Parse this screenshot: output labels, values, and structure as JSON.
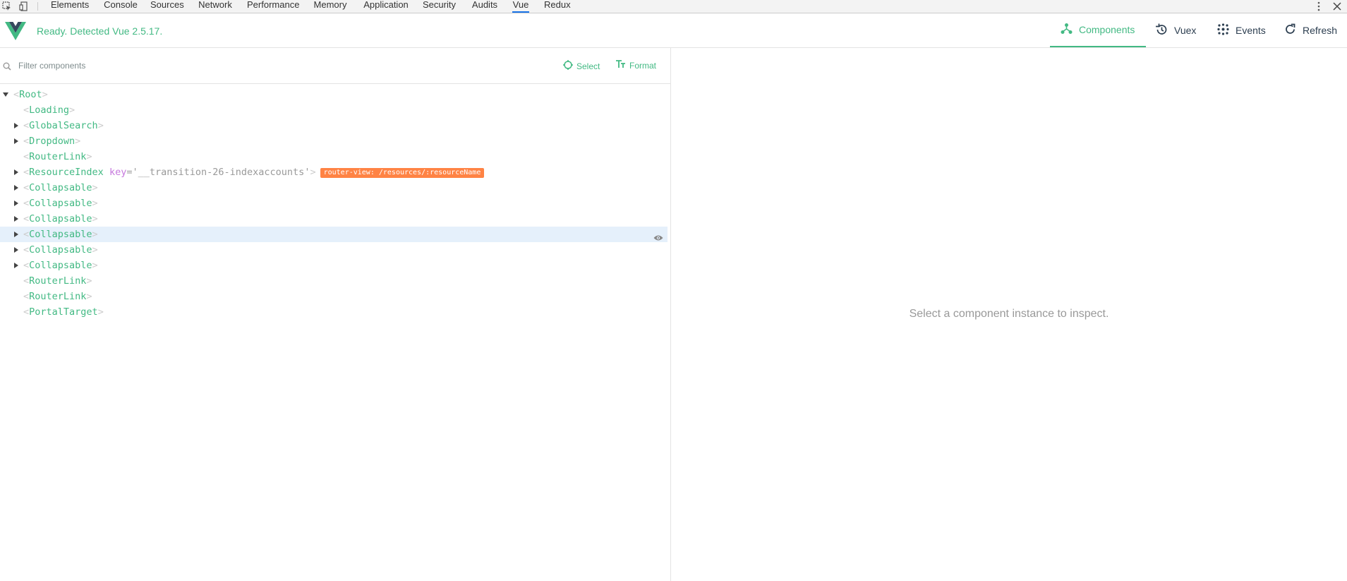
{
  "devtools": {
    "tabs": [
      {
        "label": "Elements"
      },
      {
        "label": "Console"
      },
      {
        "label": "Sources"
      },
      {
        "label": "Network"
      },
      {
        "label": "Performance"
      },
      {
        "label": "Memory"
      },
      {
        "label": "Application"
      },
      {
        "label": "Security"
      },
      {
        "label": "Audits"
      },
      {
        "label": "Vue"
      },
      {
        "label": "Redux"
      }
    ],
    "active_tab": "Vue"
  },
  "header": {
    "status": "Ready. Detected Vue 2.5.17.",
    "nav": [
      {
        "label": "Components",
        "icon": "components-icon",
        "active": true
      },
      {
        "label": "Vuex",
        "icon": "history-icon",
        "active": false
      },
      {
        "label": "Events",
        "icon": "events-icon",
        "active": false
      },
      {
        "label": "Refresh",
        "icon": "refresh-icon",
        "active": false
      }
    ]
  },
  "filter": {
    "placeholder": "Filter components",
    "select_label": "Select",
    "format_label": "Format"
  },
  "tree": [
    {
      "name": "Root",
      "depth": 0,
      "expand": "down"
    },
    {
      "name": "Loading",
      "depth": 1,
      "expand": "none"
    },
    {
      "name": "GlobalSearch",
      "depth": 1,
      "expand": "right"
    },
    {
      "name": "Dropdown",
      "depth": 1,
      "expand": "right"
    },
    {
      "name": "RouterLink",
      "depth": 1,
      "expand": "none"
    },
    {
      "name": "ResourceIndex",
      "depth": 1,
      "expand": "right",
      "key_attr": "key",
      "key_value": "'__transition-26-indexaccounts'",
      "badge": "router-view: /resources/:resourceName"
    },
    {
      "name": "Collapsable",
      "depth": 1,
      "expand": "right"
    },
    {
      "name": "Collapsable",
      "depth": 1,
      "expand": "right"
    },
    {
      "name": "Collapsable",
      "depth": 1,
      "expand": "right"
    },
    {
      "name": "Collapsable",
      "depth": 1,
      "expand": "right",
      "selected": true
    },
    {
      "name": "Collapsable",
      "depth": 1,
      "expand": "right"
    },
    {
      "name": "Collapsable",
      "depth": 1,
      "expand": "right"
    },
    {
      "name": "RouterLink",
      "depth": 1,
      "expand": "none"
    },
    {
      "name": "RouterLink",
      "depth": 1,
      "expand": "none"
    },
    {
      "name": "PortalTarget",
      "depth": 1,
      "expand": "none"
    }
  ],
  "inspector": {
    "empty_message": "Select a component instance to inspect."
  },
  "colors": {
    "vue_green": "#42b983",
    "vue_dark": "#35495e",
    "badge_orange": "#ff8344",
    "selected_row": "#e5f0fb"
  }
}
